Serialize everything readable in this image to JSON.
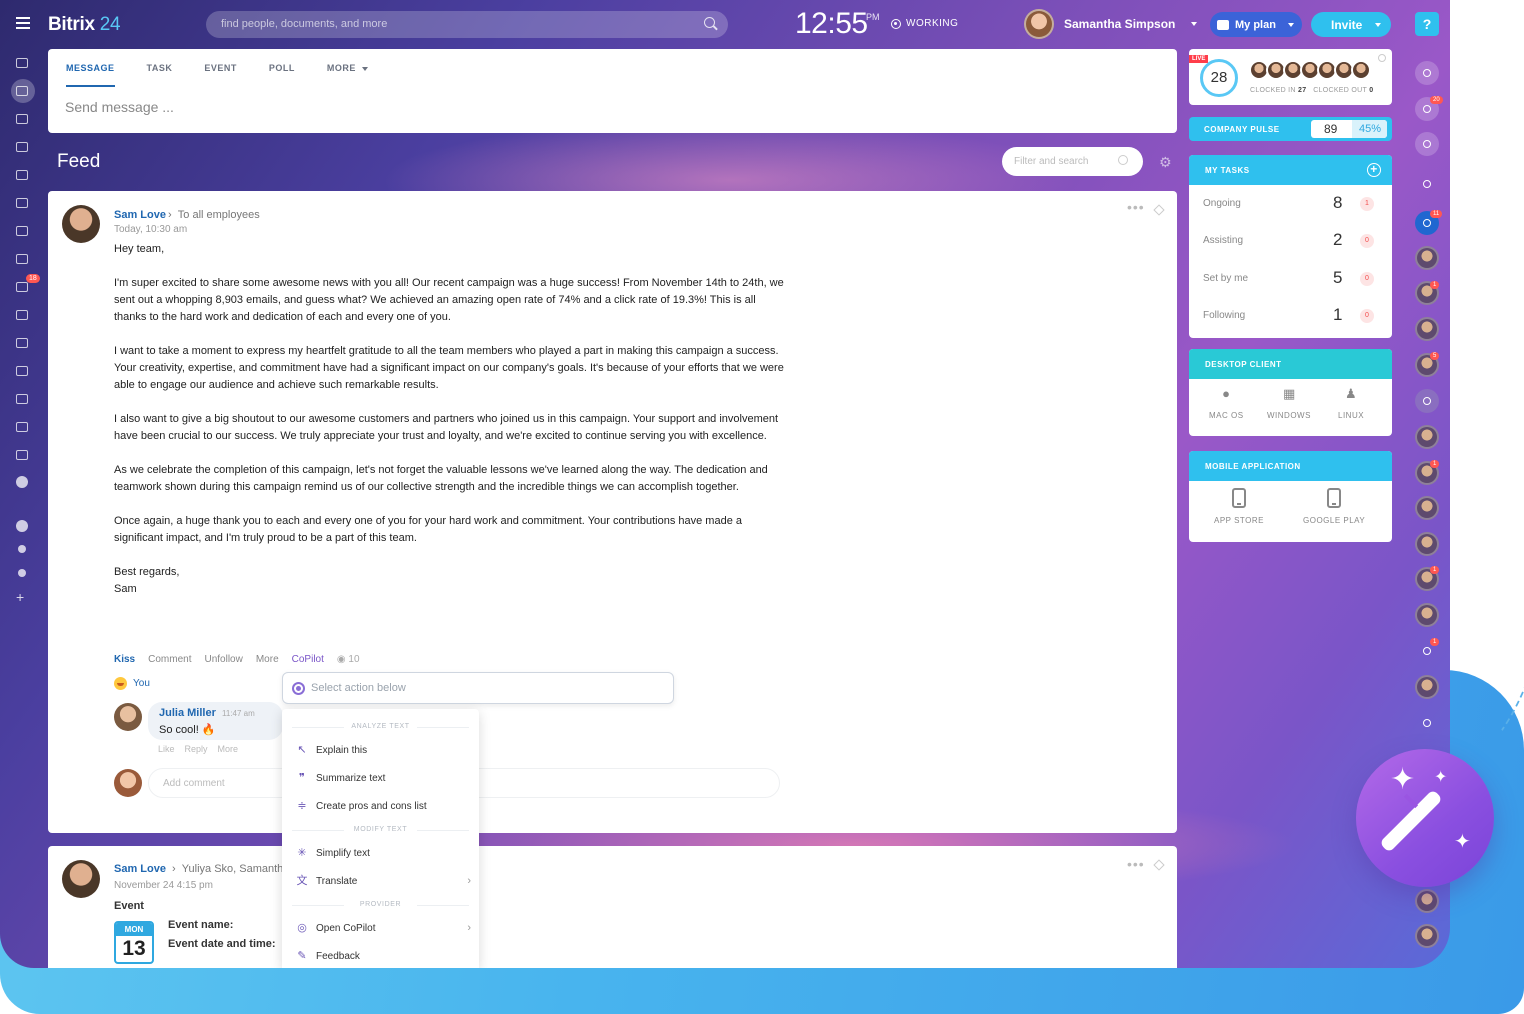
{
  "app": {
    "logo_main": "Bitrix",
    "logo_num": "24"
  },
  "topbar": {
    "search_placeholder": "find people, documents, and more",
    "clock": "12:55",
    "ampm": "PM",
    "status": "WORKING",
    "user_name": "Samantha Simpson",
    "plan_label": "My plan",
    "invite_label": "Invite"
  },
  "left_nav": {
    "badge": "18"
  },
  "composer": {
    "tabs": [
      "MESSAGE",
      "TASK",
      "EVENT",
      "POLL",
      "MORE"
    ],
    "placeholder": "Send message ..."
  },
  "feed": {
    "title": "Feed",
    "filter_placeholder": "Filter and search"
  },
  "post": {
    "author": "Sam Love",
    "to": "To all employees",
    "time": "Today, 10:30 am",
    "greeting": "Hey team,",
    "paragraphs": [
      "I'm super excited to share some awesome news with you all! Our recent campaign was a huge success! From November 14th to 24th, we sent out a whopping 8,903 emails, and guess what? We achieved an amazing open rate of 74% and a click rate of 19.3%! This is all thanks to the hard work and dedication of each and every one of you.",
      "I want to take a moment to express my heartfelt gratitude to all the team members who played a part in making this campaign a success. Your creativity, expertise, and commitment have had a significant impact on our company's goals. It's because of your efforts that we were able to engage our audience and achieve such remarkable results.",
      "I also want to give a big shoutout to our awesome customers and partners who joined us in this campaign. Your support and involvement have been crucial to our success. We truly appreciate your trust and loyalty, and we're excited to continue serving you with excellence.",
      "As we celebrate the completion of this campaign, let's not forget the valuable lessons we've learned along the way. The dedication and teamwork shown during this campaign remind us of our collective strength and the incredible things we can accomplish together.",
      "Once again, a huge thank you to each and every one of you for your hard work and commitment. Your contributions have made a significant impact, and I'm truly proud to be a part of this team."
    ],
    "signoff_1": "Best regards,",
    "signoff_2": "Sam",
    "actions": {
      "kiss": "Kiss",
      "comment": "Comment",
      "unfollow": "Unfollow",
      "more": "More",
      "copilot": "CoPilot",
      "views": "10"
    },
    "reaction_user": "You",
    "comment": {
      "author": "Julia Miller",
      "time": "11:47 am",
      "text": "So cool! 🔥",
      "like": "Like",
      "reply": "Reply",
      "more": "More"
    },
    "add_comment_placeholder": "Add comment"
  },
  "copilot": {
    "input_placeholder": "Select action below",
    "sections": {
      "analyze": "ANALYZE TEXT",
      "modify": "MODIFY TEXT",
      "provider": "PROVIDER"
    },
    "items": {
      "explain": "Explain this",
      "summarize": "Summarize text",
      "pros_cons": "Create pros and cons list",
      "simplify": "Simplify text",
      "translate": "Translate",
      "open": "Open CoPilot",
      "feedback": "Feedback"
    }
  },
  "post2": {
    "author": "Sam Love",
    "to": "Yuliya Sko, Samantha",
    "time": "November 24 4:15 pm",
    "event_label": "Event",
    "cal_day": "MON",
    "cal_num": "13",
    "event_name_label": "Event name:",
    "event_date_label": "Event date and time:"
  },
  "widgets": {
    "live": {
      "tag": "LIVE",
      "count": "28",
      "clocked_in_label": "CLOCKED IN",
      "clocked_in": "27",
      "clocked_out_label": "CLOCKED OUT",
      "clocked_out": "0"
    },
    "pulse": {
      "label": "COMPANY PULSE",
      "value": "89",
      "percent": "45%",
      "percent_value": 45
    },
    "tasks": {
      "title": "MY TASKS",
      "rows": [
        {
          "label": "Ongoing",
          "count": "8",
          "overdue": "1"
        },
        {
          "label": "Assisting",
          "count": "2",
          "overdue": "0"
        },
        {
          "label": "Set by me",
          "count": "5",
          "overdue": "0"
        },
        {
          "label": "Following",
          "count": "1",
          "overdue": "0"
        }
      ]
    },
    "desktop": {
      "title": "DESKTOP CLIENT",
      "macos": "MAC OS",
      "windows": "WINDOWS",
      "linux": "LINUX"
    },
    "mobile": {
      "title": "MOBILE APPLICATION",
      "appstore": "APP STORE",
      "googleplay": "GOOGLE PLAY"
    }
  },
  "right_rail": {
    "badges": [
      "20",
      "11",
      "1",
      "5",
      "1",
      "1",
      "1"
    ]
  },
  "colors": {
    "accent_blue": "#2fc0ee",
    "link_blue": "#2067b0",
    "copilot_purple": "#7a55c8",
    "badge_red": "#ff5752"
  }
}
